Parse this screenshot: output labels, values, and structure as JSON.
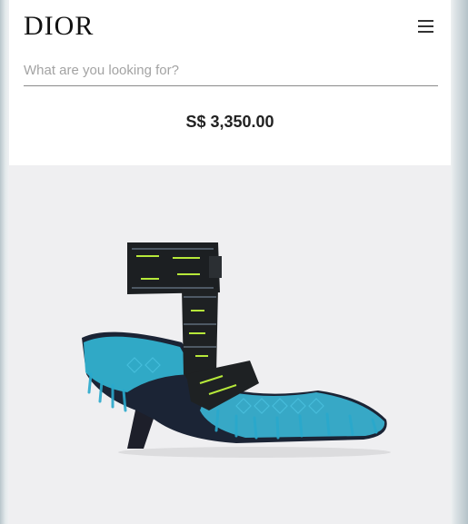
{
  "brand": {
    "logo_text": "DIOR"
  },
  "header": {
    "menu_icon": "hamburger-menu-icon"
  },
  "search": {
    "placeholder": "What are you looking for?",
    "value": ""
  },
  "product": {
    "price": "S$ 3,350.00",
    "image_icon": "fringed-pump-shoe-image"
  }
}
